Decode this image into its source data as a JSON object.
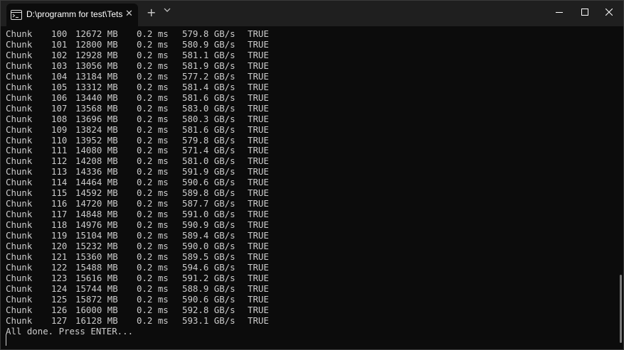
{
  "tab": {
    "title": "D:\\programm for test\\Tets GPU",
    "icon": "terminal-icon",
    "close_icon": "close-icon"
  },
  "titlebar": {
    "new_tab_icon": "plus-icon",
    "dropdown_icon": "chevron-down-icon",
    "minimize_icon": "minimize-icon",
    "maximize_icon": "maximize-icon",
    "close_icon": "close-icon"
  },
  "colors": {
    "background": "#0c0c0c",
    "titlebar": "#1f1f1f",
    "text": "#cccccc"
  },
  "rows": [
    {
      "label": "Chunk",
      "index": "100",
      "size": "12672 MB",
      "time": "0.2 ms",
      "speed": "579.8 GB/s",
      "ok": "TRUE"
    },
    {
      "label": "Chunk",
      "index": "101",
      "size": "12800 MB",
      "time": "0.2 ms",
      "speed": "580.9 GB/s",
      "ok": "TRUE"
    },
    {
      "label": "Chunk",
      "index": "102",
      "size": "12928 MB",
      "time": "0.2 ms",
      "speed": "581.1 GB/s",
      "ok": "TRUE"
    },
    {
      "label": "Chunk",
      "index": "103",
      "size": "13056 MB",
      "time": "0.2 ms",
      "speed": "581.9 GB/s",
      "ok": "TRUE"
    },
    {
      "label": "Chunk",
      "index": "104",
      "size": "13184 MB",
      "time": "0.2 ms",
      "speed": "577.2 GB/s",
      "ok": "TRUE"
    },
    {
      "label": "Chunk",
      "index": "105",
      "size": "13312 MB",
      "time": "0.2 ms",
      "speed": "581.4 GB/s",
      "ok": "TRUE"
    },
    {
      "label": "Chunk",
      "index": "106",
      "size": "13440 MB",
      "time": "0.2 ms",
      "speed": "581.6 GB/s",
      "ok": "TRUE"
    },
    {
      "label": "Chunk",
      "index": "107",
      "size": "13568 MB",
      "time": "0.2 ms",
      "speed": "583.0 GB/s",
      "ok": "TRUE"
    },
    {
      "label": "Chunk",
      "index": "108",
      "size": "13696 MB",
      "time": "0.2 ms",
      "speed": "580.3 GB/s",
      "ok": "TRUE"
    },
    {
      "label": "Chunk",
      "index": "109",
      "size": "13824 MB",
      "time": "0.2 ms",
      "speed": "581.6 GB/s",
      "ok": "TRUE"
    },
    {
      "label": "Chunk",
      "index": "110",
      "size": "13952 MB",
      "time": "0.2 ms",
      "speed": "579.8 GB/s",
      "ok": "TRUE"
    },
    {
      "label": "Chunk",
      "index": "111",
      "size": "14080 MB",
      "time": "0.2 ms",
      "speed": "571.4 GB/s",
      "ok": "TRUE"
    },
    {
      "label": "Chunk",
      "index": "112",
      "size": "14208 MB",
      "time": "0.2 ms",
      "speed": "581.0 GB/s",
      "ok": "TRUE"
    },
    {
      "label": "Chunk",
      "index": "113",
      "size": "14336 MB",
      "time": "0.2 ms",
      "speed": "591.9 GB/s",
      "ok": "TRUE"
    },
    {
      "label": "Chunk",
      "index": "114",
      "size": "14464 MB",
      "time": "0.2 ms",
      "speed": "590.6 GB/s",
      "ok": "TRUE"
    },
    {
      "label": "Chunk",
      "index": "115",
      "size": "14592 MB",
      "time": "0.2 ms",
      "speed": "589.8 GB/s",
      "ok": "TRUE"
    },
    {
      "label": "Chunk",
      "index": "116",
      "size": "14720 MB",
      "time": "0.2 ms",
      "speed": "587.7 GB/s",
      "ok": "TRUE"
    },
    {
      "label": "Chunk",
      "index": "117",
      "size": "14848 MB",
      "time": "0.2 ms",
      "speed": "591.0 GB/s",
      "ok": "TRUE"
    },
    {
      "label": "Chunk",
      "index": "118",
      "size": "14976 MB",
      "time": "0.2 ms",
      "speed": "590.9 GB/s",
      "ok": "TRUE"
    },
    {
      "label": "Chunk",
      "index": "119",
      "size": "15104 MB",
      "time": "0.2 ms",
      "speed": "589.4 GB/s",
      "ok": "TRUE"
    },
    {
      "label": "Chunk",
      "index": "120",
      "size": "15232 MB",
      "time": "0.2 ms",
      "speed": "590.0 GB/s",
      "ok": "TRUE"
    },
    {
      "label": "Chunk",
      "index": "121",
      "size": "15360 MB",
      "time": "0.2 ms",
      "speed": "589.5 GB/s",
      "ok": "TRUE"
    },
    {
      "label": "Chunk",
      "index": "122",
      "size": "15488 MB",
      "time": "0.2 ms",
      "speed": "594.6 GB/s",
      "ok": "TRUE"
    },
    {
      "label": "Chunk",
      "index": "123",
      "size": "15616 MB",
      "time": "0.2 ms",
      "speed": "591.2 GB/s",
      "ok": "TRUE"
    },
    {
      "label": "Chunk",
      "index": "124",
      "size": "15744 MB",
      "time": "0.2 ms",
      "speed": "588.9 GB/s",
      "ok": "TRUE"
    },
    {
      "label": "Chunk",
      "index": "125",
      "size": "15872 MB",
      "time": "0.2 ms",
      "speed": "590.6 GB/s",
      "ok": "TRUE"
    },
    {
      "label": "Chunk",
      "index": "126",
      "size": "16000 MB",
      "time": "0.2 ms",
      "speed": "592.8 GB/s",
      "ok": "TRUE"
    },
    {
      "label": "Chunk",
      "index": "127",
      "size": "16128 MB",
      "time": "0.2 ms",
      "speed": "593.1 GB/s",
      "ok": "TRUE"
    }
  ],
  "footer": "All done. Press ENTER..."
}
